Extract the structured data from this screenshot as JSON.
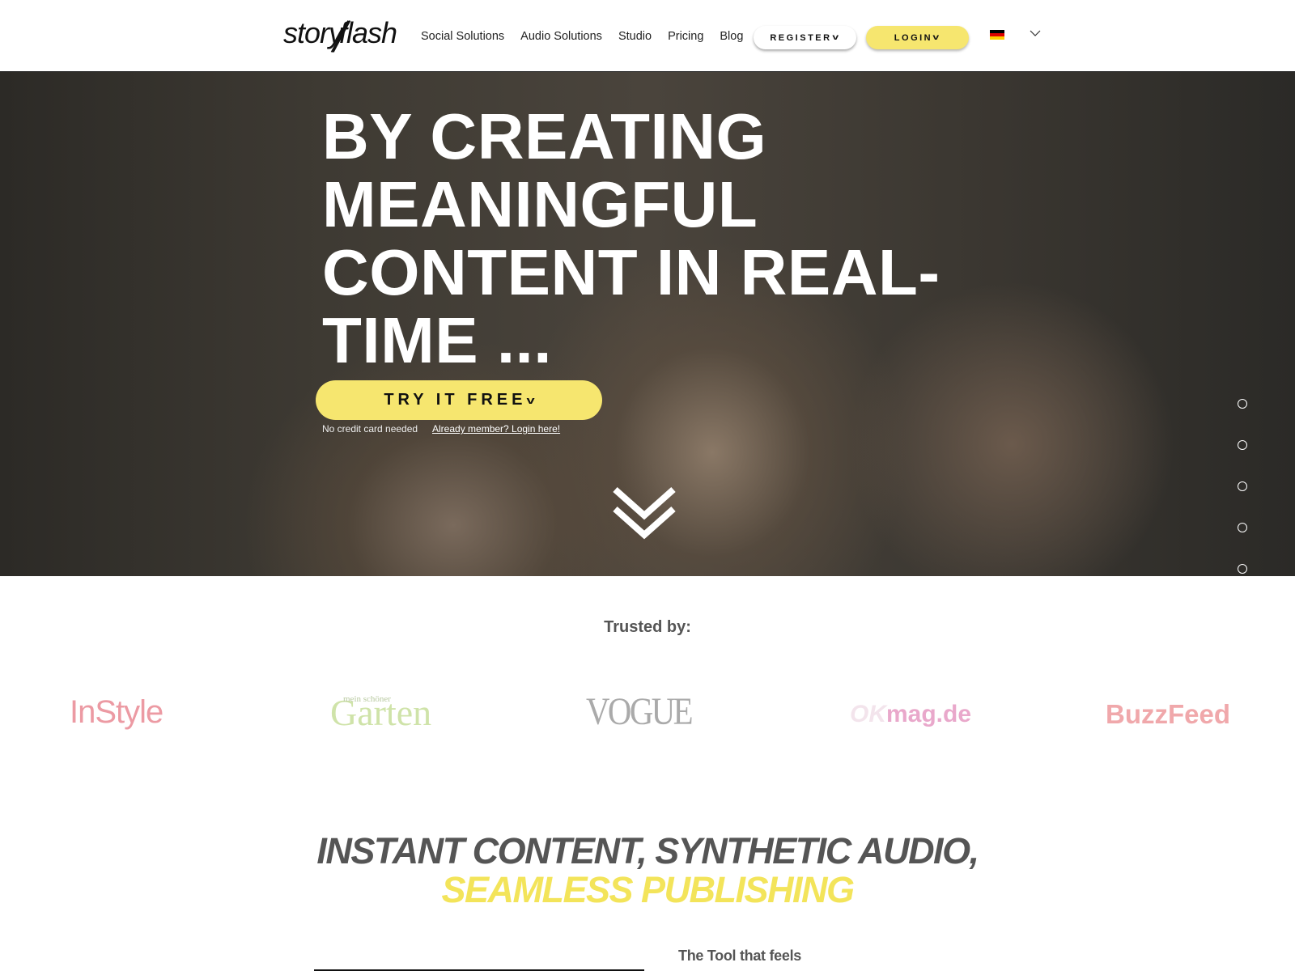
{
  "header": {
    "logo": "storyflash",
    "nav": [
      "Social Solutions",
      "Audio Solutions",
      "Studio",
      "Pricing",
      "Blog"
    ],
    "register_label": "REGISTER",
    "login_label": "LOGIN",
    "language_flag": "de-flag-icon"
  },
  "hero": {
    "title_lines": [
      "BY CREATING",
      "MEANINGFUL",
      "CONTENT IN REAL-",
      "TIME ..."
    ],
    "cta_label": "TRY IT FREE",
    "no_card_text": "No credit card needed",
    "login_link": "Already member? Login here!",
    "slide_count": 5,
    "colors": {
      "accent": "#f6e66f"
    }
  },
  "trusted": {
    "heading": "Trusted by:",
    "logos": [
      "InStyle",
      "mein schöner Garten",
      "VOGUE",
      "OKmag.de",
      "BuzzFeed"
    ]
  },
  "section": {
    "heading_line1": "INSTANT CONTENT, SYNTHETIC AUDIO,",
    "heading_line2": "SEAMLESS PUBLISHING",
    "subheading": "The Tool that feels"
  }
}
